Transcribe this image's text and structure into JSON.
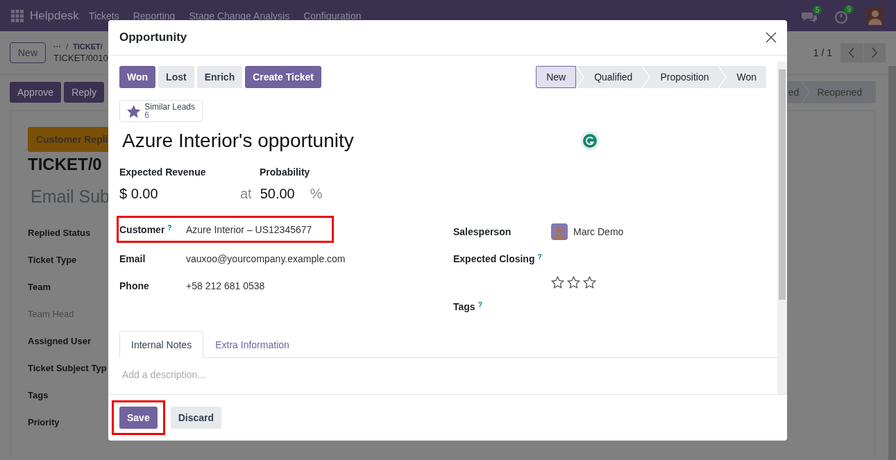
{
  "navbar": {
    "app": "Helpdesk",
    "menu": [
      "Tickets",
      "Reporting",
      "Stage Change Analysis",
      "Configuration"
    ],
    "chat_count": "5",
    "activity_count": "9"
  },
  "control_panel": {
    "new_button": "New",
    "breadcrumb_more": "···",
    "breadcrumb_separator": "/",
    "breadcrumb_parent": "TICKET/",
    "record": "TICKET/0010",
    "pager": "1 / 1"
  },
  "actions": [
    "Approve",
    "Reply"
  ],
  "ticket_stages": [
    {
      "label": "ed"
    },
    {
      "label": "Reopened"
    }
  ],
  "ticket": {
    "badge": "Customer Repli",
    "number": "TICKET/0",
    "subject": "Email Sub",
    "fields": [
      {
        "label": "Replied Status",
        "readonly": false
      },
      {
        "label": "Ticket Type",
        "readonly": false
      },
      {
        "label": "Team",
        "readonly": false
      },
      {
        "label": "Team Head",
        "readonly": true
      },
      {
        "label": "Assigned User",
        "readonly": false
      },
      {
        "label": "Ticket Subject Typ",
        "readonly": false
      },
      {
        "label": "Tags",
        "readonly": false
      },
      {
        "label": "Priority",
        "readonly": false
      }
    ]
  },
  "dialog": {
    "title": "Opportunity",
    "buttons": [
      {
        "label": "Won",
        "primary": true
      },
      {
        "label": "Lost",
        "primary": false
      },
      {
        "label": "Enrich",
        "primary": false
      },
      {
        "label": "Create Ticket",
        "primary": true
      }
    ],
    "stages": [
      {
        "label": "New",
        "selected": true
      },
      {
        "label": "Qualified",
        "selected": false
      },
      {
        "label": "Proposition",
        "selected": false
      },
      {
        "label": "Won",
        "selected": false
      }
    ],
    "smart_button": {
      "label": "Similar Leads",
      "count": "6"
    },
    "name": "Azure Interior's opportunity",
    "revenue": {
      "label": "Expected Revenue",
      "value": "$ 0.00"
    },
    "probability": {
      "label": "Probability",
      "connector": "at",
      "value": "50.00",
      "unit": "%"
    },
    "left_fields": [
      {
        "label": "Customer",
        "help": "?",
        "value": "Azure Interior – US12345677",
        "highlighted": true
      },
      {
        "label": "Email",
        "value": "vauxoo@yourcompany.example.com",
        "highlighted": false
      },
      {
        "label": "Phone",
        "value": "+58 212 681 0538",
        "highlighted": false
      }
    ],
    "salesperson": {
      "label": "Salesperson",
      "value": "Marc Demo"
    },
    "expected_closing": {
      "label": "Expected Closing",
      "help": "?"
    },
    "priority": {
      "stars": 0
    },
    "tags": {
      "label": "Tags",
      "help": "?"
    },
    "tabs": [
      {
        "label": "Internal Notes",
        "selected": true
      },
      {
        "label": "Extra Information",
        "selected": false
      }
    ],
    "description": {
      "placeholder": "Add a description..."
    },
    "footer_buttons": [
      {
        "label": "Save",
        "primary": true,
        "highlighted": true
      },
      {
        "label": "Discard",
        "primary": false,
        "highlighted": false
      }
    ]
  }
}
